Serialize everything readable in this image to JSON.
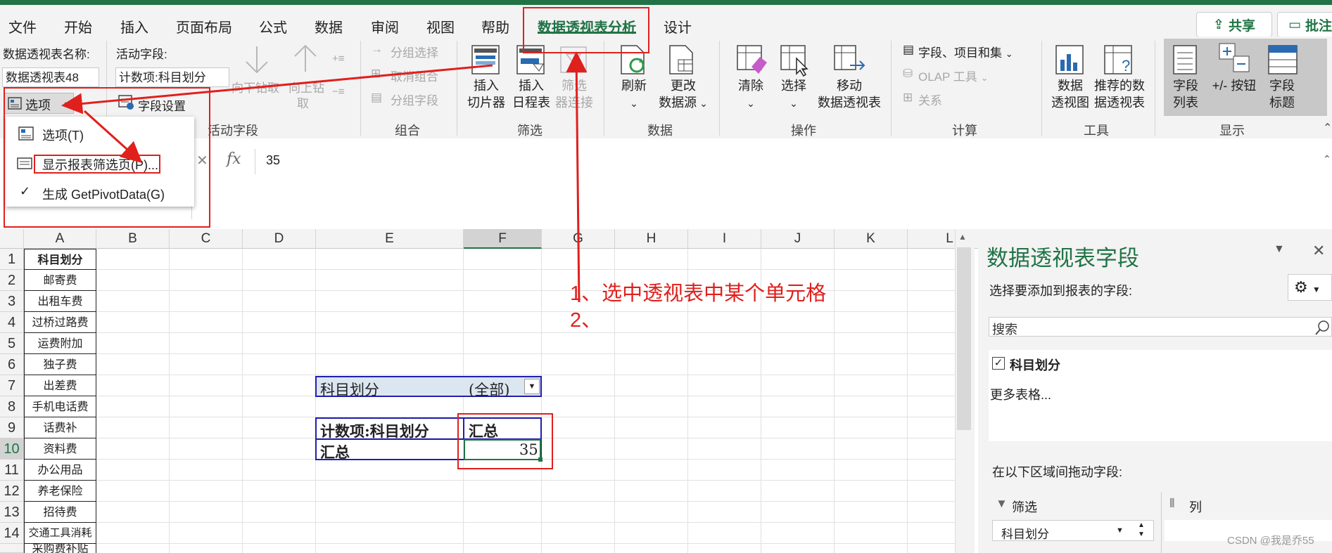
{
  "ribbon_tabs": [
    "文件",
    "开始",
    "插入",
    "页面布局",
    "公式",
    "数据",
    "审阅",
    "视图",
    "帮助",
    "数据透视表分析",
    "设计"
  ],
  "share_label": "共享",
  "comment_label": "批注",
  "pivot_name_label": "数据透视表名称:",
  "pivot_name_value": "数据透视表48",
  "options_button": "选项",
  "active_field_label": "活动字段:",
  "active_field_value": "计数项:科目划分",
  "field_settings": "字段设置",
  "drill_down": "向下钻取",
  "drill_up_a": "向上钻",
  "drill_up_b": "取",
  "group_selection": "分组选择",
  "ungroup": "取消组合",
  "group_field": "分组字段",
  "insert_slicer_a": "插入",
  "insert_slicer_b": "切片器",
  "insert_timeline_a": "插入",
  "insert_timeline_b": "日程表",
  "filter_conn_a": "筛选",
  "filter_conn_b": "器连接",
  "refresh": "刷新",
  "change_source_a": "更改",
  "change_source_b": "数据源",
  "clear": "清除",
  "select": "选择",
  "move_a": "移动",
  "move_b": "数据透视表",
  "fields_items_sets": "字段、项目和集",
  "olap_tools": "OLAP 工具",
  "relationships": "关系",
  "pivot_chart_a": "数据",
  "pivot_chart_b": "透视图",
  "recommended_a": "推荐的数",
  "recommended_b": "据透视表",
  "field_list_a": "字段",
  "field_list_b": "列表",
  "plus_minus": "+/- 按钮",
  "field_headers_a": "字段",
  "field_headers_b": "标题",
  "groups": {
    "active_field": "活动字段",
    "group": "组合",
    "filter": "筛选",
    "data": "数据",
    "actions": "操作",
    "calc": "计算",
    "tools": "工具",
    "show": "显示"
  },
  "menu_items": [
    "选项(T)",
    "显示报表筛选页(P)...",
    "生成 GetPivotData(G)"
  ],
  "formula_fx": "fx",
  "formula_value": "35",
  "columns": [
    "A",
    "B",
    "C",
    "D",
    "E",
    "F",
    "G",
    "H",
    "I",
    "J",
    "K",
    "L"
  ],
  "rows": [
    "1",
    "2",
    "3",
    "4",
    "5",
    "6",
    "7",
    "8",
    "9",
    "10",
    "11",
    "12",
    "13",
    "14"
  ],
  "col_a_cells": [
    "科目划分",
    "邮寄费",
    "出租车费",
    "过桥过路费",
    "运费附加",
    "独子费",
    "出差费",
    "手机电话费",
    "话费补",
    "资料费",
    "办公用品",
    "养老保险",
    "招待费",
    "交通工具消耗"
  ],
  "row15_partial": "采购费补贴",
  "pivot": {
    "filter_field": "科目划分",
    "filter_value": "(全部)",
    "count_label": "计数项:科目划分",
    "total_header": "汇总",
    "total_row_label": "汇总",
    "total_value": "35"
  },
  "annotation_1": "1、选中透视表中某个单元格",
  "annotation_2": "2、",
  "pane": {
    "title": "数据透视表字段",
    "choose_label": "选择要添加到报表的字段:",
    "search_placeholder": "搜索",
    "field_item": "科目划分",
    "more_tables": "更多表格...",
    "drag_label": "在以下区域间拖动字段:",
    "filters_label": "筛选",
    "columns_label": "列",
    "filter_chip": "科目划分"
  },
  "watermark": "CSDN @我是乔55",
  "colors": {
    "accent": "#217346",
    "annotation": "#e0201c",
    "pivot_border": "#1f1fb0"
  }
}
